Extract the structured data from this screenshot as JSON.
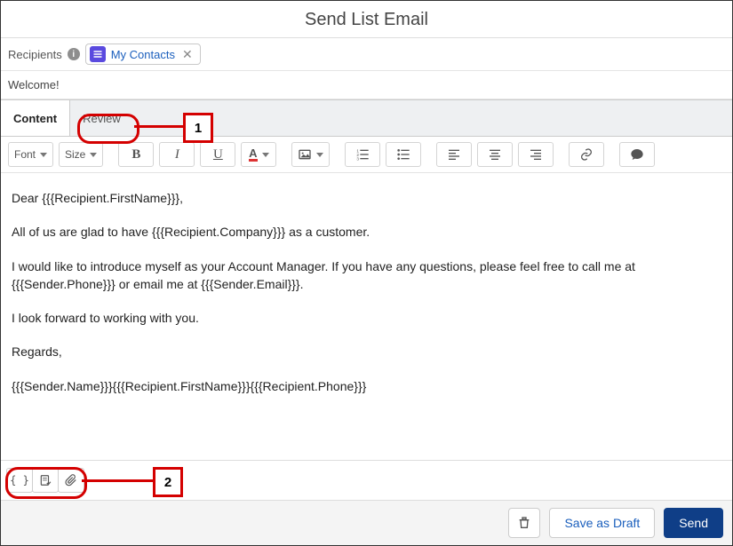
{
  "header": {
    "title": "Send List Email"
  },
  "recipients": {
    "label": "Recipients",
    "pill": {
      "label": "My Contacts"
    }
  },
  "subject": {
    "value": "Welcome!"
  },
  "tabs": {
    "content": "Content",
    "review": "Review"
  },
  "toolbar": {
    "font": "Font",
    "size": "Size"
  },
  "body": {
    "p1": "Dear {{{Recipient.FirstName}}},",
    "p2": "All of us are glad to have {{{Recipient.Company}}} as a customer.",
    "p3": "I would like to introduce myself as your Account Manager.  If you have any questions, please feel free to call me at {{{Sender.Phone}}} or email me at {{{Sender.Email}}}.",
    "p4": "I look forward to working with you.",
    "p5": "Regards,",
    "p6": "{{{Sender.Name}}}{{{Recipient.FirstName}}}{{{Recipient.Phone}}}"
  },
  "footer": {
    "save_draft": "Save as Draft",
    "send": "Send"
  },
  "annotations": {
    "one": "1",
    "two": "2"
  }
}
